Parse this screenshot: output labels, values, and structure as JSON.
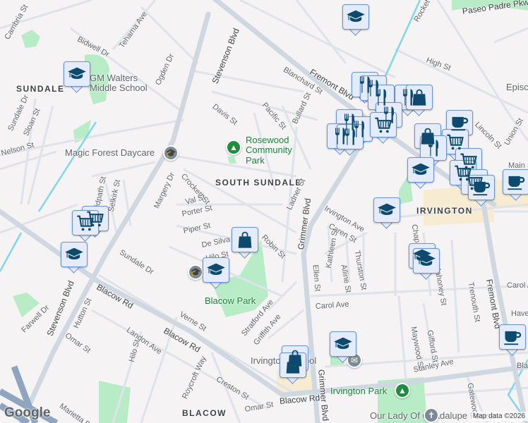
{
  "colors": {
    "land": "#f5f3f3",
    "road": "#d7dde5",
    "major_road": "#c9d2dd",
    "highway": "#8fa4bf",
    "park": "#b7ecc6",
    "water": "#7fd6ee",
    "commercial": "#f7ecd2",
    "marker_fill": "#e4ecfc",
    "marker_border": "#6a93d8",
    "icon": "#0d4a6e"
  },
  "neighborhoods": [
    "SUNDALE",
    "SOUTH SUNDALE",
    "IRVINGTON",
    "BLACOW"
  ],
  "pois": {
    "walters": "GM Walters Middle School",
    "magic_forest": "Magic Forest Daycare",
    "rosewood": "Rosewood Community Park",
    "blacow_park": "Blacow Park",
    "irvington_park": "Irvington Park",
    "irvington_school": "Irvington School",
    "our_lady": "Our Lady Of Guadalupe Parish",
    "episcopal": "Episc"
  },
  "streets": [
    "Cambria St",
    "Bidwell Dr",
    "Tehama Ave",
    "Ogden Dr",
    "Stevenson Blvd",
    "Davis St",
    "Sundale Dr",
    "Sloan St",
    "Nelson St",
    "Bidpath St",
    "Selkirk St",
    "Margery Dr",
    "Crockett St",
    "Val St",
    "Porter St",
    "Piper St",
    "De Silva",
    "Hilo St",
    "Robin St",
    "Sundale Dr",
    "Stevenson Blvd",
    "Blacow Rd",
    "Blacow Rd",
    "Hutton St",
    "Farwell Dr",
    "Omar St",
    "Landon Ave",
    "Hilo St",
    "Verne St",
    "Roycroft Way",
    "Creston St",
    "Marietta Dr",
    "Omar St",
    "Stratford Ave",
    "Griffith Ave",
    "Fremont Blvd",
    "Blanchard St",
    "Pacific St",
    "Bullard St",
    "Ladner St",
    "Grimmer Blvd",
    "Irvington Ave",
    "Caren St",
    "Ellen St",
    "Kathleen St",
    "Alline St",
    "Thurston St",
    "Carol Ave",
    "Mahoney St",
    "Trenouth St",
    "Maywood St",
    "Gifford St",
    "Stanley Ave",
    "Blacow Rd",
    "Fremont Blvd",
    "High St",
    "Lincoln St",
    "Union St",
    "Main St",
    "Paseo Padre Pkwy",
    "Rocket",
    "Gatewood",
    "Have",
    "Chap",
    "Grimmer Blvd",
    "Carol A",
    "Bla"
  ],
  "map": {
    "logo": "Google",
    "attribution": "Map data ©2026"
  }
}
